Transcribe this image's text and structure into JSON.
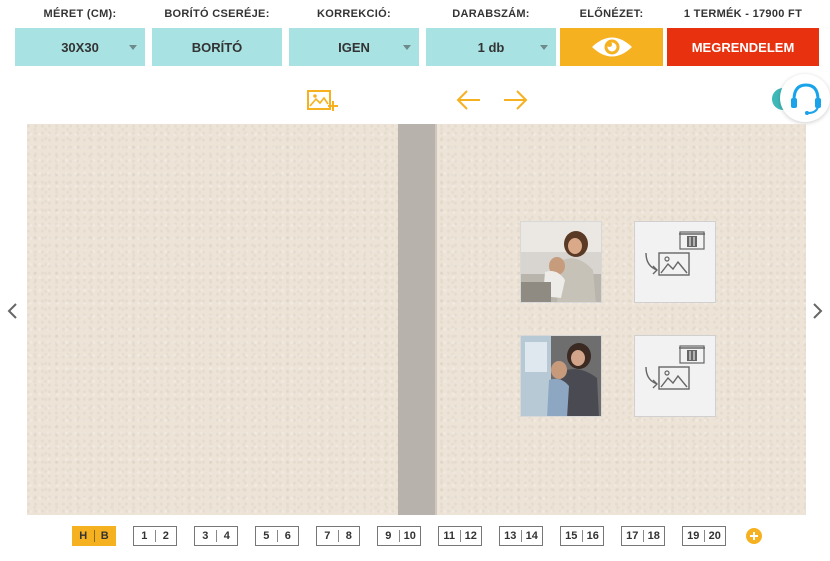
{
  "header": {
    "size_label": "MÉRET (CM):",
    "size_value": "30X30",
    "cover_label": "BORÍTÓ CSERÉJE:",
    "cover_value": "BORÍTÓ",
    "correction_label": "KORREKCIÓ:",
    "correction_value": "IGEN",
    "quantity_label": "DARABSZÁM:",
    "quantity_value": "1 db",
    "preview_label": "ELŐNÉZET:",
    "price_summary": "1 TERMÉK - 17900 FT",
    "order_label": "MEGRENDELEM"
  },
  "colors": {
    "teal": "#a9e2e2",
    "orange": "#f6b120",
    "red": "#e8310f",
    "support_blue": "#1aa3e8"
  },
  "icons": {
    "add_image": "add-image-icon",
    "undo": "arrow-left-icon",
    "redo": "arrow-right-icon",
    "preview": "eye-icon",
    "support": "headset-icon",
    "delete": "trash-icon",
    "placeholder": "image-placeholder-icon"
  },
  "pages": {
    "tabs": [
      {
        "left": "H",
        "right": "B",
        "active": true
      },
      {
        "left": "1",
        "right": "2"
      },
      {
        "left": "3",
        "right": "4"
      },
      {
        "left": "5",
        "right": "6"
      },
      {
        "left": "7",
        "right": "8"
      },
      {
        "left": "9",
        "right": "10"
      },
      {
        "left": "11",
        "right": "12"
      },
      {
        "left": "13",
        "right": "14"
      },
      {
        "left": "15",
        "right": "16"
      },
      {
        "left": "17",
        "right": "18"
      },
      {
        "left": "19",
        "right": "20"
      }
    ]
  }
}
